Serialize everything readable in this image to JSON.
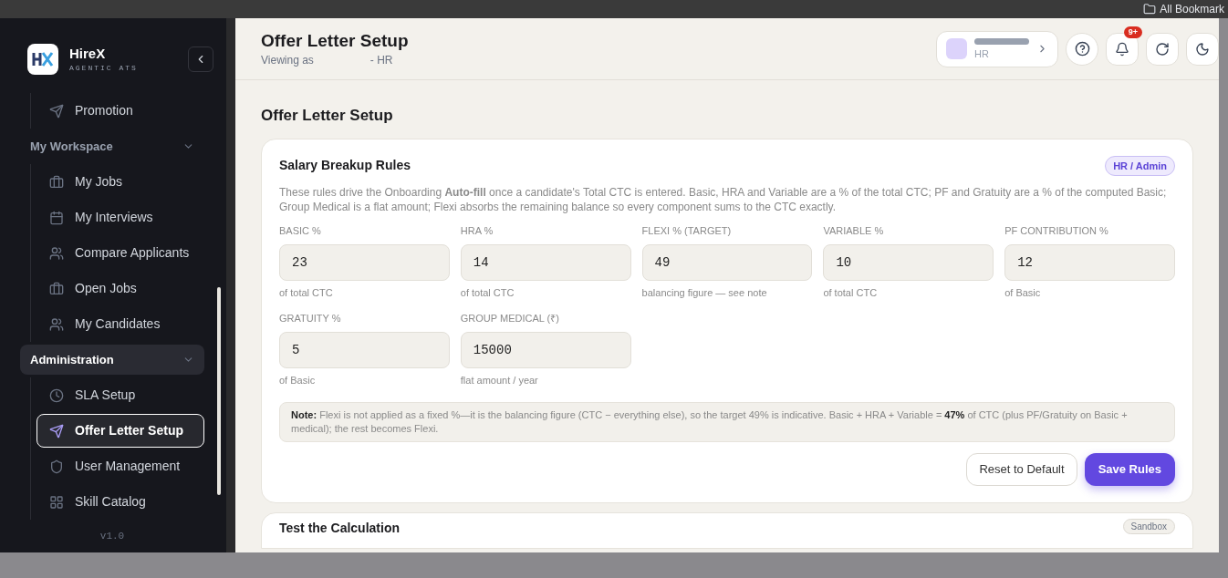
{
  "browser": {
    "bookmarks_label": "All Bookmark"
  },
  "sidebar": {
    "brand": {
      "name": "HireX",
      "tagline": "AGENTIC ATS"
    },
    "top_items": [
      {
        "label": "Promotion",
        "selected": false
      }
    ],
    "groups": [
      {
        "label": "My Workspace",
        "expanded": true,
        "highlighted": false,
        "items": [
          {
            "label": "My Jobs",
            "selected": false
          },
          {
            "label": "My Interviews",
            "selected": false
          },
          {
            "label": "Compare Applicants",
            "selected": false
          },
          {
            "label": "Open Jobs",
            "selected": false
          },
          {
            "label": "My Candidates",
            "selected": false
          }
        ]
      },
      {
        "label": "Administration",
        "expanded": true,
        "highlighted": true,
        "items": [
          {
            "label": "SLA Setup",
            "selected": false
          },
          {
            "label": "Offer Letter Setup",
            "selected": true
          },
          {
            "label": "User Management",
            "selected": false
          },
          {
            "label": "Skill Catalog",
            "selected": false
          }
        ]
      }
    ],
    "version": "v1.0"
  },
  "header": {
    "title": "Offer Letter Setup",
    "viewing_prefix": "Viewing as",
    "viewing_suffix": "- HR",
    "user_role": "HR",
    "notification_badge": "9+"
  },
  "page_title": "Offer Letter Setup",
  "rules_card": {
    "title": "Salary Breakup Rules",
    "badge": "HR / Admin",
    "description": "These rules drive the Onboarding **Auto-fill** once a candidate's Total CTC is entered. Basic, HRA and Variable are a % of the total CTC; PF and Gratuity are a % of the computed Basic; Group Medical is a flat amount; Flexi absorbs the remaining balance so every component sums to the CTC exactly.",
    "fields": [
      {
        "label": "BASIC %",
        "value": "23",
        "hint": "of total CTC"
      },
      {
        "label": "HRA %",
        "value": "14",
        "hint": "of total CTC"
      },
      {
        "label": "FLEXI % (TARGET)",
        "value": "49",
        "hint": "balancing figure — see note"
      },
      {
        "label": "VARIABLE %",
        "value": "10",
        "hint": "of total CTC"
      },
      {
        "label": "PF CONTRIBUTION %",
        "value": "12",
        "hint": "of Basic"
      },
      {
        "label": "GRATUITY %",
        "value": "5",
        "hint": "of Basic"
      },
      {
        "label": "GROUP MEDICAL (₹)",
        "value": "15000",
        "hint": "flat amount / year"
      }
    ],
    "note": "**Note:** Flexi is not applied as a fixed %—it is the balancing figure (CTC − everything else), so the target 49% is indicative. Basic + HRA + Variable = **47%** of CTC (plus PF/Gratuity on Basic + medical); the rest becomes Flexi.",
    "buttons": [
      {
        "label": "Reset to Default",
        "kind": "secondary"
      },
      {
        "label": "Save Rules",
        "kind": "primary"
      }
    ]
  },
  "test_card": {
    "title": "Test the Calculation",
    "badge": "Sandbox"
  }
}
